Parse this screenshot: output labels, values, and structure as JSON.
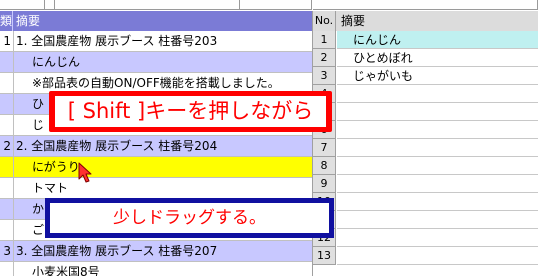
{
  "left_grid": {
    "header": {
      "col_num": "類",
      "col_summary": "摘要"
    },
    "rows": [
      {
        "num": "1",
        "text": "1. 全国農産物 展示ブース 柱番号203",
        "bg": "white"
      },
      {
        "num": "",
        "text": "にんじん",
        "bg": "lavender"
      },
      {
        "num": "",
        "text": "※部品表の自動ON/OFF機能を搭載しました。",
        "bg": "white"
      },
      {
        "num": "",
        "text": "ひ",
        "bg": "lavender"
      },
      {
        "num": "",
        "text": "じ",
        "bg": "white"
      },
      {
        "num": "2",
        "text": "2. 全国農産物 展示ブース 柱番号204",
        "bg": "lavender"
      },
      {
        "num": "",
        "text": "にがうり",
        "bg": "yellow"
      },
      {
        "num": "",
        "text": "トマト",
        "bg": "white"
      },
      {
        "num": "",
        "text": "か",
        "bg": "lavender"
      },
      {
        "num": "",
        "text": "ご",
        "bg": "white"
      },
      {
        "num": "3",
        "text": "3. 全国農産物 展示ブース 柱番号207",
        "bg": "lavender"
      },
      {
        "num": "",
        "text": "小麦米国8号",
        "bg": "white"
      }
    ]
  },
  "right_grid": {
    "header": {
      "col_num": "No.",
      "col_summary": "摘要"
    },
    "rows": [
      {
        "num": "1",
        "text": "にんじん",
        "selected": true
      },
      {
        "num": "2",
        "text": "ひとめぼれ",
        "selected": false
      },
      {
        "num": "3",
        "text": "じゃがいも",
        "selected": false
      },
      {
        "num": "4",
        "text": "",
        "selected": false
      },
      {
        "num": "5",
        "text": "",
        "selected": false
      },
      {
        "num": "6",
        "text": "",
        "selected": false
      },
      {
        "num": "7",
        "text": "",
        "selected": false
      },
      {
        "num": "8",
        "text": "",
        "selected": false
      },
      {
        "num": "9",
        "text": "",
        "selected": false
      },
      {
        "num": "10",
        "text": "",
        "selected": false
      },
      {
        "num": "11",
        "text": "",
        "selected": false
      },
      {
        "num": "12",
        "text": "",
        "selected": false
      },
      {
        "num": "13",
        "text": "",
        "selected": false
      }
    ]
  },
  "overlays": {
    "instruction_1": "[ Shift ]キーを押しながら",
    "instruction_2": "少しドラッグする。"
  },
  "colors": {
    "header_blue": "#7b7bd6",
    "row_lavender": "#c8c8ff",
    "row_yellow": "#ffff00",
    "selected_cyan": "#bff0f0",
    "callout_red": "#ff0000",
    "callout_navy": "#1010a0"
  },
  "icons": {
    "cursor": "mouse-pointer-icon"
  }
}
